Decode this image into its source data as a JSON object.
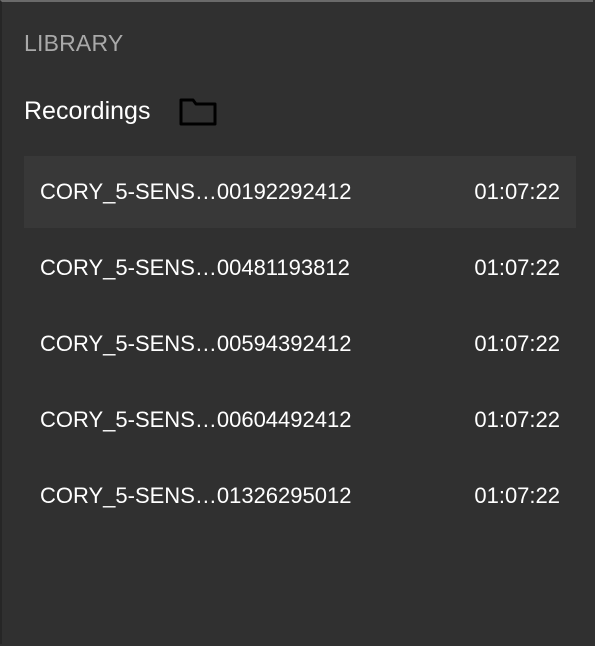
{
  "library": {
    "section_label": "LIBRARY",
    "header_title": "Recordings",
    "folder_icon": "folder-icon"
  },
  "recordings": [
    {
      "name": "CORY_5-SENS…00192292412",
      "duration": "01:07:22",
      "selected": true
    },
    {
      "name": "CORY_5-SENS…00481193812",
      "duration": "01:07:22",
      "selected": false
    },
    {
      "name": "CORY_5-SENS…00594392412",
      "duration": "01:07:22",
      "selected": false
    },
    {
      "name": "CORY_5-SENS…00604492412",
      "duration": "01:07:22",
      "selected": false
    },
    {
      "name": "CORY_5-SENS…01326295012",
      "duration": "01:07:22",
      "selected": false
    }
  ],
  "colors": {
    "background": "#303030",
    "selected_row": "#383838",
    "text": "#ffffff",
    "muted_text": "#a9a9a9"
  }
}
